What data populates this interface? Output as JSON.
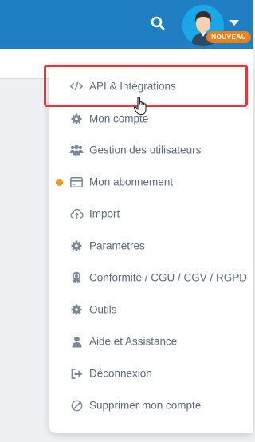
{
  "header": {
    "search_icon": "search-icon",
    "avatar_icon": "user-avatar",
    "badge": "NOUVEAU"
  },
  "menu": {
    "items": [
      {
        "label": "API & Intégrations",
        "icon": "code-icon"
      },
      {
        "label": "Mon compte",
        "icon": "gear-icon"
      },
      {
        "label": "Gestion des utilisateurs",
        "icon": "users-icon"
      },
      {
        "label": "Mon abonnement",
        "icon": "credit-card-icon"
      },
      {
        "label": "Import",
        "icon": "cloud-upload-icon"
      },
      {
        "label": "Paramètres",
        "icon": "gear-icon"
      },
      {
        "label": "Conformité / CGU / CGV / RGPD",
        "icon": "award-icon"
      },
      {
        "label": "Outils",
        "icon": "gear-icon"
      },
      {
        "label": "Aide et Assistance",
        "icon": "user-icon"
      },
      {
        "label": "Déconnexion",
        "icon": "sign-out-icon"
      },
      {
        "label": "Supprimer mon compte",
        "icon": "ban-icon"
      }
    ]
  },
  "colors": {
    "header_bg": "#1f7fc2",
    "badge_bg": "#ef7d1a",
    "highlight": "#e0393f",
    "notification_dot": "#f7941d",
    "menu_text": "#5a6a7e",
    "icon_color": "#7a8899"
  }
}
